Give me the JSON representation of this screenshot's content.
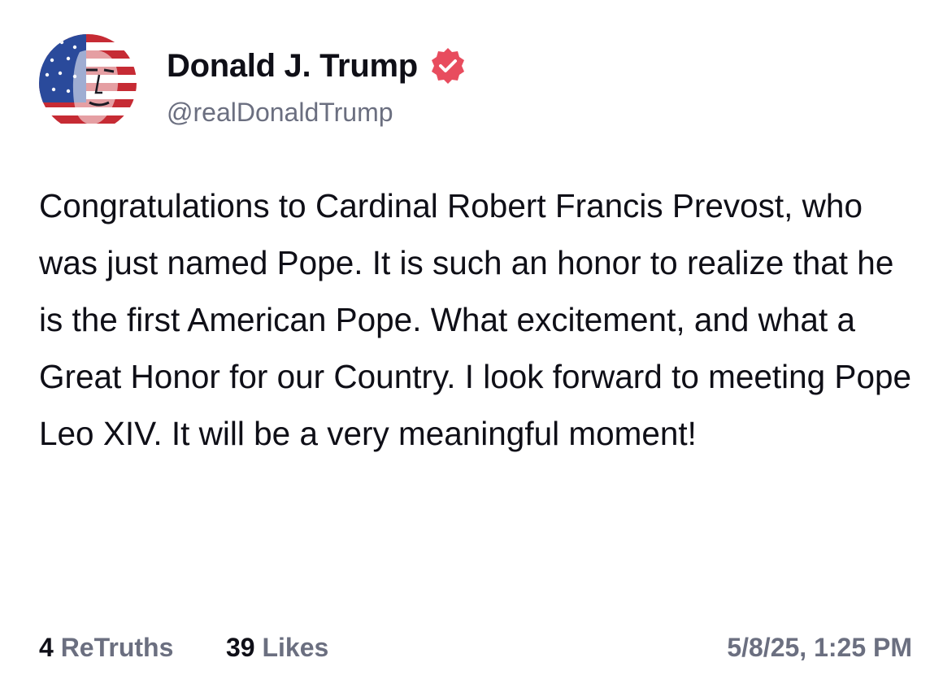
{
  "author": {
    "display_name": "Donald J. Trump",
    "handle": "@realDonaldTrump",
    "verified": true
  },
  "post": {
    "text": "Congratulations to Cardinal Robert Francis Prevost, who was just named Pope. It is such an honor to realize that he is the first American Pope. What excitement, and what a Great Honor for our Country. I look forward to meeting Pope Leo XIV. It will be a very meaningful moment!",
    "retruths_count": "4",
    "retruths_label": "ReTruths",
    "likes_count": "39",
    "likes_label": "Likes",
    "timestamp": "5/8/25, 1:25 PM"
  },
  "icons": {
    "avatar": "flag-portrait-avatar",
    "verified": "verified-badge-icon"
  },
  "colors": {
    "text": "#0f0f17",
    "secondary": "#6b6f80",
    "verified_badge": "#e84c5e"
  }
}
